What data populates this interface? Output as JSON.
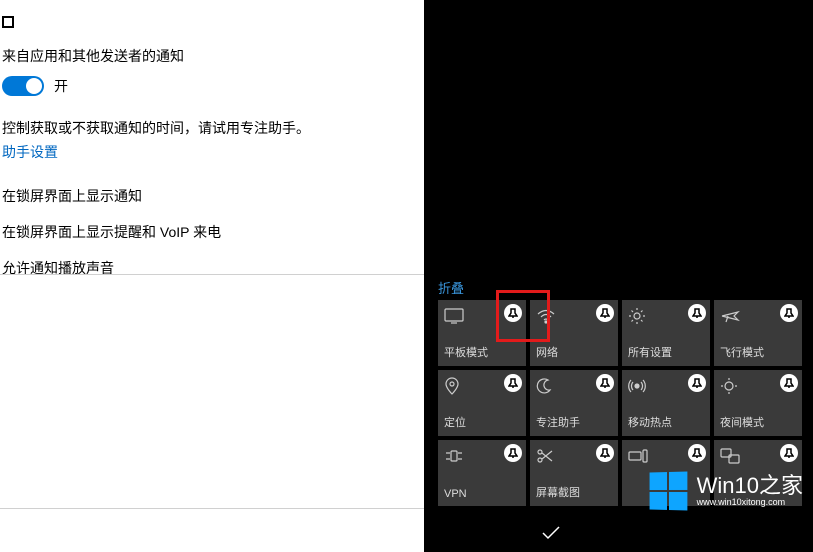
{
  "settings": {
    "section_label": "来自应用和其他发送者的通知",
    "toggle_state": "开",
    "desc": "控制获取或不获取通知的时间，请试用专注助手。",
    "link": "助手设置",
    "opt1": "在锁屏界面上显示通知",
    "opt2": "在锁屏界面上显示提醒和 VoIP 来电",
    "opt3": "允许通知播放声音"
  },
  "action_center": {
    "collapse": "折叠",
    "tiles": [
      {
        "label": "平板模式",
        "icon": "tablet"
      },
      {
        "label": "网络",
        "icon": "wifi"
      },
      {
        "label": "所有设置",
        "icon": "gear"
      },
      {
        "label": "飞行模式",
        "icon": "airplane"
      },
      {
        "label": "定位",
        "icon": "location"
      },
      {
        "label": "专注助手",
        "icon": "moon"
      },
      {
        "label": "移动热点",
        "icon": "hotspot"
      },
      {
        "label": "夜间模式",
        "icon": "night"
      },
      {
        "label": "VPN",
        "icon": "vpn"
      },
      {
        "label": "屏幕截图",
        "icon": "snip"
      },
      {
        "label": "",
        "icon": "connect"
      },
      {
        "label": "",
        "icon": "project"
      }
    ]
  },
  "watermark": {
    "title": "Win10之家",
    "sub": "www.win10xitong.com"
  }
}
